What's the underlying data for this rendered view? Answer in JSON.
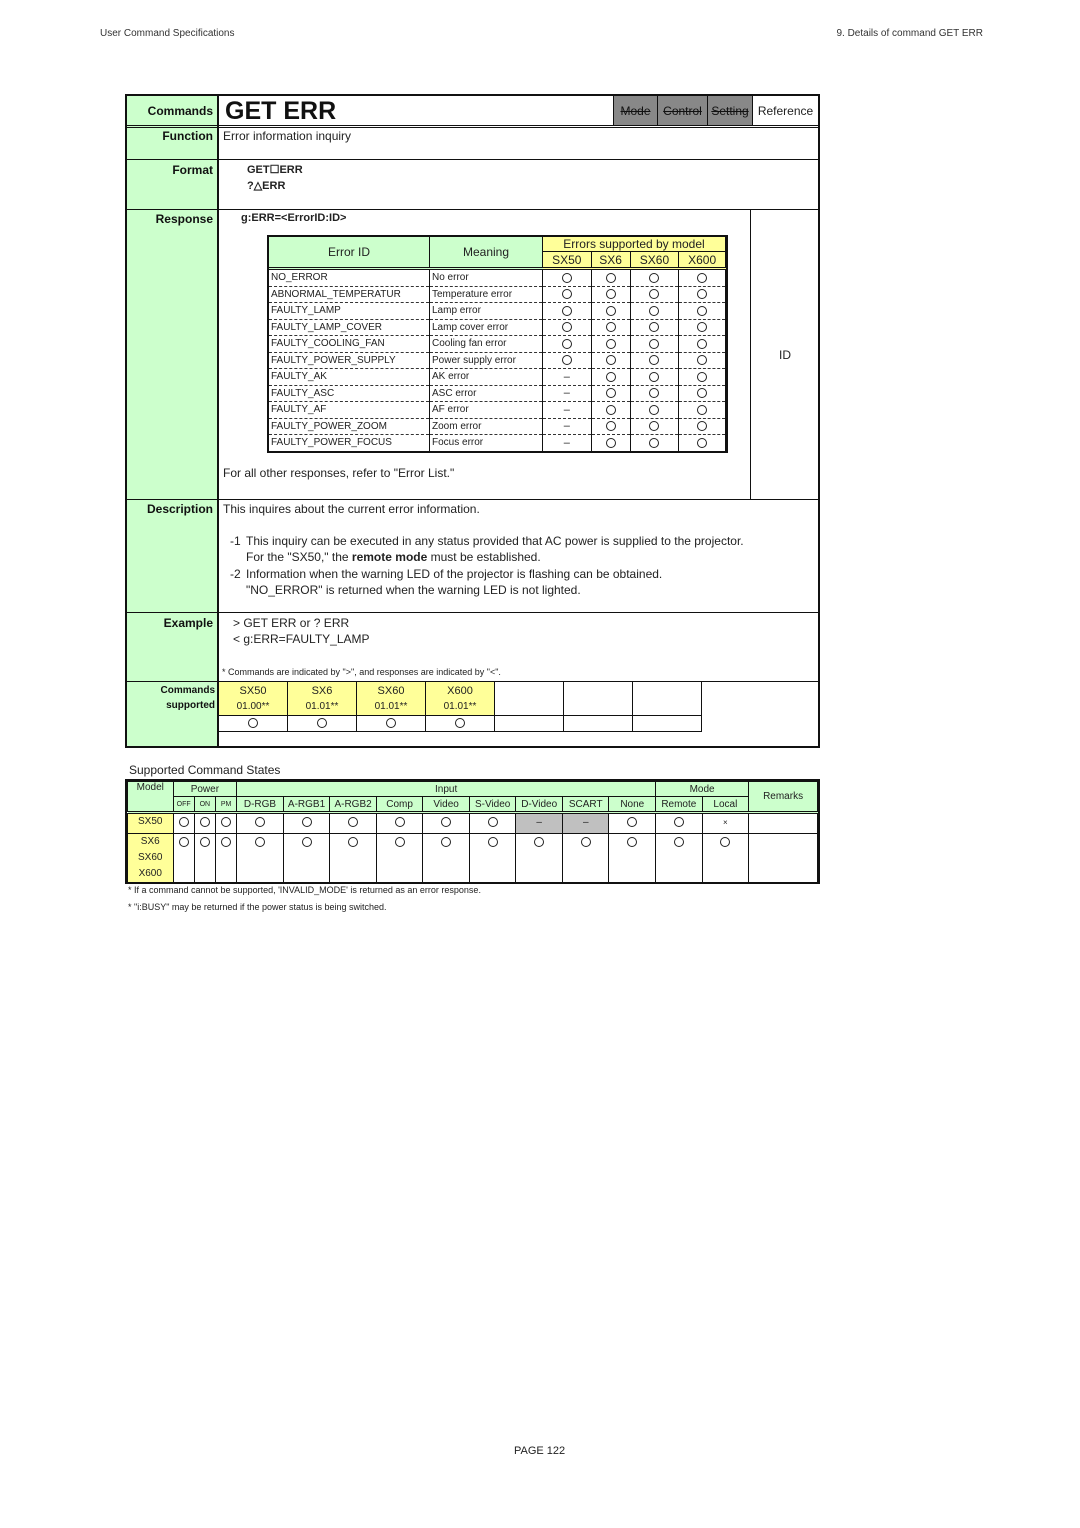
{
  "page_header": {
    "left": "User Command Specifications",
    "right": "9. Details of command  GET ERR"
  },
  "command": {
    "label": "Commands",
    "name": "GET ERR",
    "tags": [
      {
        "label": "Mode",
        "active": false
      },
      {
        "label": "Control",
        "active": false
      },
      {
        "label": "Setting",
        "active": false
      },
      {
        "label": "Reference",
        "active": true
      }
    ]
  },
  "rows": {
    "function_label": "Function",
    "function_text": "Error information inquiry",
    "format_label": "Format",
    "format_lines": [
      "GET☐ERR",
      "?△ERR"
    ],
    "response_label": "Response",
    "response_syntax": "g:ERR=<ErrorID:ID>",
    "response_side_label": "ID",
    "response_note": "For all other responses, refer to \"Error List.\"",
    "description_label": "Description",
    "description_intro": "This inquires about the current error information.",
    "description_items": [
      {
        "num": "-1",
        "line1": "This inquiry can be executed in any status provided that AC power is supplied to the projector.",
        "line2_pre": "For the \"SX50,\" the ",
        "line2_bold": "remote mode",
        "line2_post": " must be established."
      },
      {
        "num": "-2",
        "line1": "Information when the warning LED of the projector is flashing can be obtained.",
        "line2_pre": "\"NO_ERROR\" is returned when the warning LED is not lighted.",
        "line2_bold": "",
        "line2_post": ""
      }
    ],
    "example_label": "Example",
    "example_lines": [
      "> GET ERR or ? ERR",
      "< g:ERR=FAULTY_LAMP"
    ],
    "example_note": "* Commands are indicated by \">\", and responses are indicated by \"<\".",
    "commands_supported_label": [
      "Commands",
      "supported"
    ]
  },
  "error_table": {
    "headers": {
      "error_id": "Error ID",
      "meaning": "Meaning",
      "group": "Errors supported by model"
    },
    "models": [
      "SX50",
      "SX6",
      "SX60",
      "X600"
    ],
    "rows": [
      {
        "id": "NO_ERROR",
        "meaning": "No error",
        "support": [
          "o",
          "o",
          "o",
          "o"
        ]
      },
      {
        "id": "ABNORMAL_TEMPERATUR",
        "meaning": "Temperature error",
        "support": [
          "o",
          "o",
          "o",
          "o"
        ]
      },
      {
        "id": "FAULTY_LAMP",
        "meaning": "Lamp error",
        "support": [
          "o",
          "o",
          "o",
          "o"
        ]
      },
      {
        "id": "FAULTY_LAMP_COVER",
        "meaning": "Lamp cover error",
        "support": [
          "o",
          "o",
          "o",
          "o"
        ]
      },
      {
        "id": "FAULTY_COOLING_FAN",
        "meaning": "Cooling fan error",
        "support": [
          "o",
          "o",
          "o",
          "o"
        ]
      },
      {
        "id": "FAULTY_POWER_SUPPLY",
        "meaning": "Power supply error",
        "support": [
          "o",
          "o",
          "o",
          "o"
        ]
      },
      {
        "id": "FAULTY_AK",
        "meaning": "AK error",
        "support": [
          "-",
          "o",
          "o",
          "o"
        ]
      },
      {
        "id": "FAULTY_ASC",
        "meaning": "ASC error",
        "support": [
          "-",
          "o",
          "o",
          "o"
        ]
      },
      {
        "id": "FAULTY_AF",
        "meaning": "AF error",
        "support": [
          "-",
          "o",
          "o",
          "o"
        ]
      },
      {
        "id": "FAULTY_POWER_ZOOM",
        "meaning": "Zoom error",
        "support": [
          "-",
          "o",
          "o",
          "o"
        ]
      },
      {
        "id": "FAULTY_POWER_FOCUS",
        "meaning": "Focus error",
        "support": [
          "-",
          "o",
          "o",
          "o"
        ]
      }
    ]
  },
  "commands_supported": [
    {
      "model": "SX50",
      "version": "01.00**",
      "support": "o"
    },
    {
      "model": "SX6",
      "version": "01.01**",
      "support": "o"
    },
    {
      "model": "SX60",
      "version": "01.01**",
      "support": "o"
    },
    {
      "model": "X600",
      "version": "01.01**",
      "support": "o"
    },
    {
      "model": "",
      "version": "",
      "support": ""
    },
    {
      "model": "",
      "version": "",
      "support": ""
    },
    {
      "model": "",
      "version": "",
      "support": ""
    }
  ],
  "states": {
    "title": "Supported Command States",
    "group_headers": {
      "model": "Model",
      "power": "Power",
      "input": "Input",
      "mode": "Mode",
      "remarks": "Remarks"
    },
    "power_cols": [
      "OFF",
      "ON",
      "PM"
    ],
    "input_cols": [
      "D-RGB",
      "A-RGB1",
      "A-RGB2",
      "Comp",
      "Video",
      "S-Video",
      "D-Video",
      "SCART",
      "None"
    ],
    "mode_cols": [
      "Remote",
      "Local"
    ],
    "rows": [
      {
        "models": [
          "SX50"
        ],
        "values": [
          "o",
          "o",
          "o",
          "o",
          "o",
          "o",
          "o",
          "o",
          "o",
          "-",
          "-",
          "o",
          "o",
          "x"
        ],
        "remarks": ""
      },
      {
        "models": [
          "SX6",
          "SX60",
          "X600"
        ],
        "values": [
          "o",
          "o",
          "o",
          "o",
          "o",
          "o",
          "o",
          "o",
          "o",
          "o",
          "o",
          "o",
          "o",
          "o"
        ],
        "remarks": ""
      }
    ],
    "footnotes": [
      "* If a command cannot be supported, 'INVALID_MODE' is returned as an error response.",
      "* \"i:BUSY\" may be returned if the power status is being switched."
    ]
  },
  "page_footer": "PAGE 122"
}
